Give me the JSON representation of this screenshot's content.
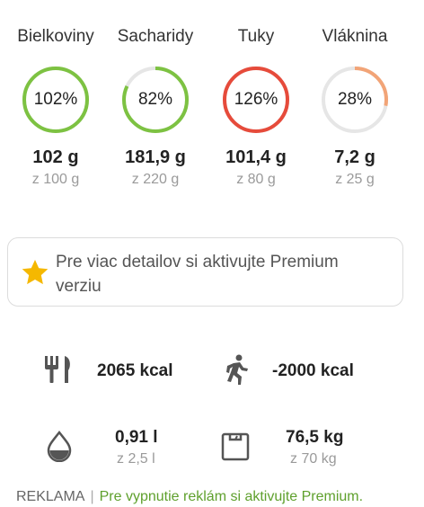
{
  "macros": [
    {
      "name": "Bielkoviny",
      "percent_text": "102%",
      "percent": 102,
      "value": "102 g",
      "goal": "z 100 g",
      "color": "#7dc242"
    },
    {
      "name": "Sacharidy",
      "percent_text": "82%",
      "percent": 82,
      "value": "181,9 g",
      "goal": "z 220 g",
      "color": "#7dc242"
    },
    {
      "name": "Tuky",
      "percent_text": "126%",
      "percent": 126,
      "value": "101,4 g",
      "goal": "z 80 g",
      "color": "#e64b3b"
    },
    {
      "name": "Vláknina",
      "percent_text": "28%",
      "percent": 28,
      "value": "7,2 g",
      "goal": "z 25 g",
      "color": "#f2a477"
    }
  ],
  "premium": {
    "text": "Pre viac detailov si aktivujte Premium verziu",
    "icon": "star-icon",
    "star_color": "#f5b800"
  },
  "stats": {
    "calories_eaten": {
      "value": "2065 kcal",
      "icon": "fork-knife-icon"
    },
    "calories_burned": {
      "value": "-2000 kcal",
      "icon": "running-person-icon"
    },
    "water": {
      "value": "0,91 l",
      "goal": "z 2,5 l",
      "icon": "water-drop-icon"
    },
    "weight": {
      "value": "76,5 kg",
      "goal": "z 70 kg",
      "icon": "scale-icon"
    }
  },
  "ad": {
    "tag": "REKLAMA",
    "separator": "|",
    "link": "Pre vypnutie reklám si aktivujte Premium."
  },
  "colors": {
    "track": "#e6e6e6",
    "icon_gray": "#555555",
    "link_green": "#5fa02d"
  }
}
